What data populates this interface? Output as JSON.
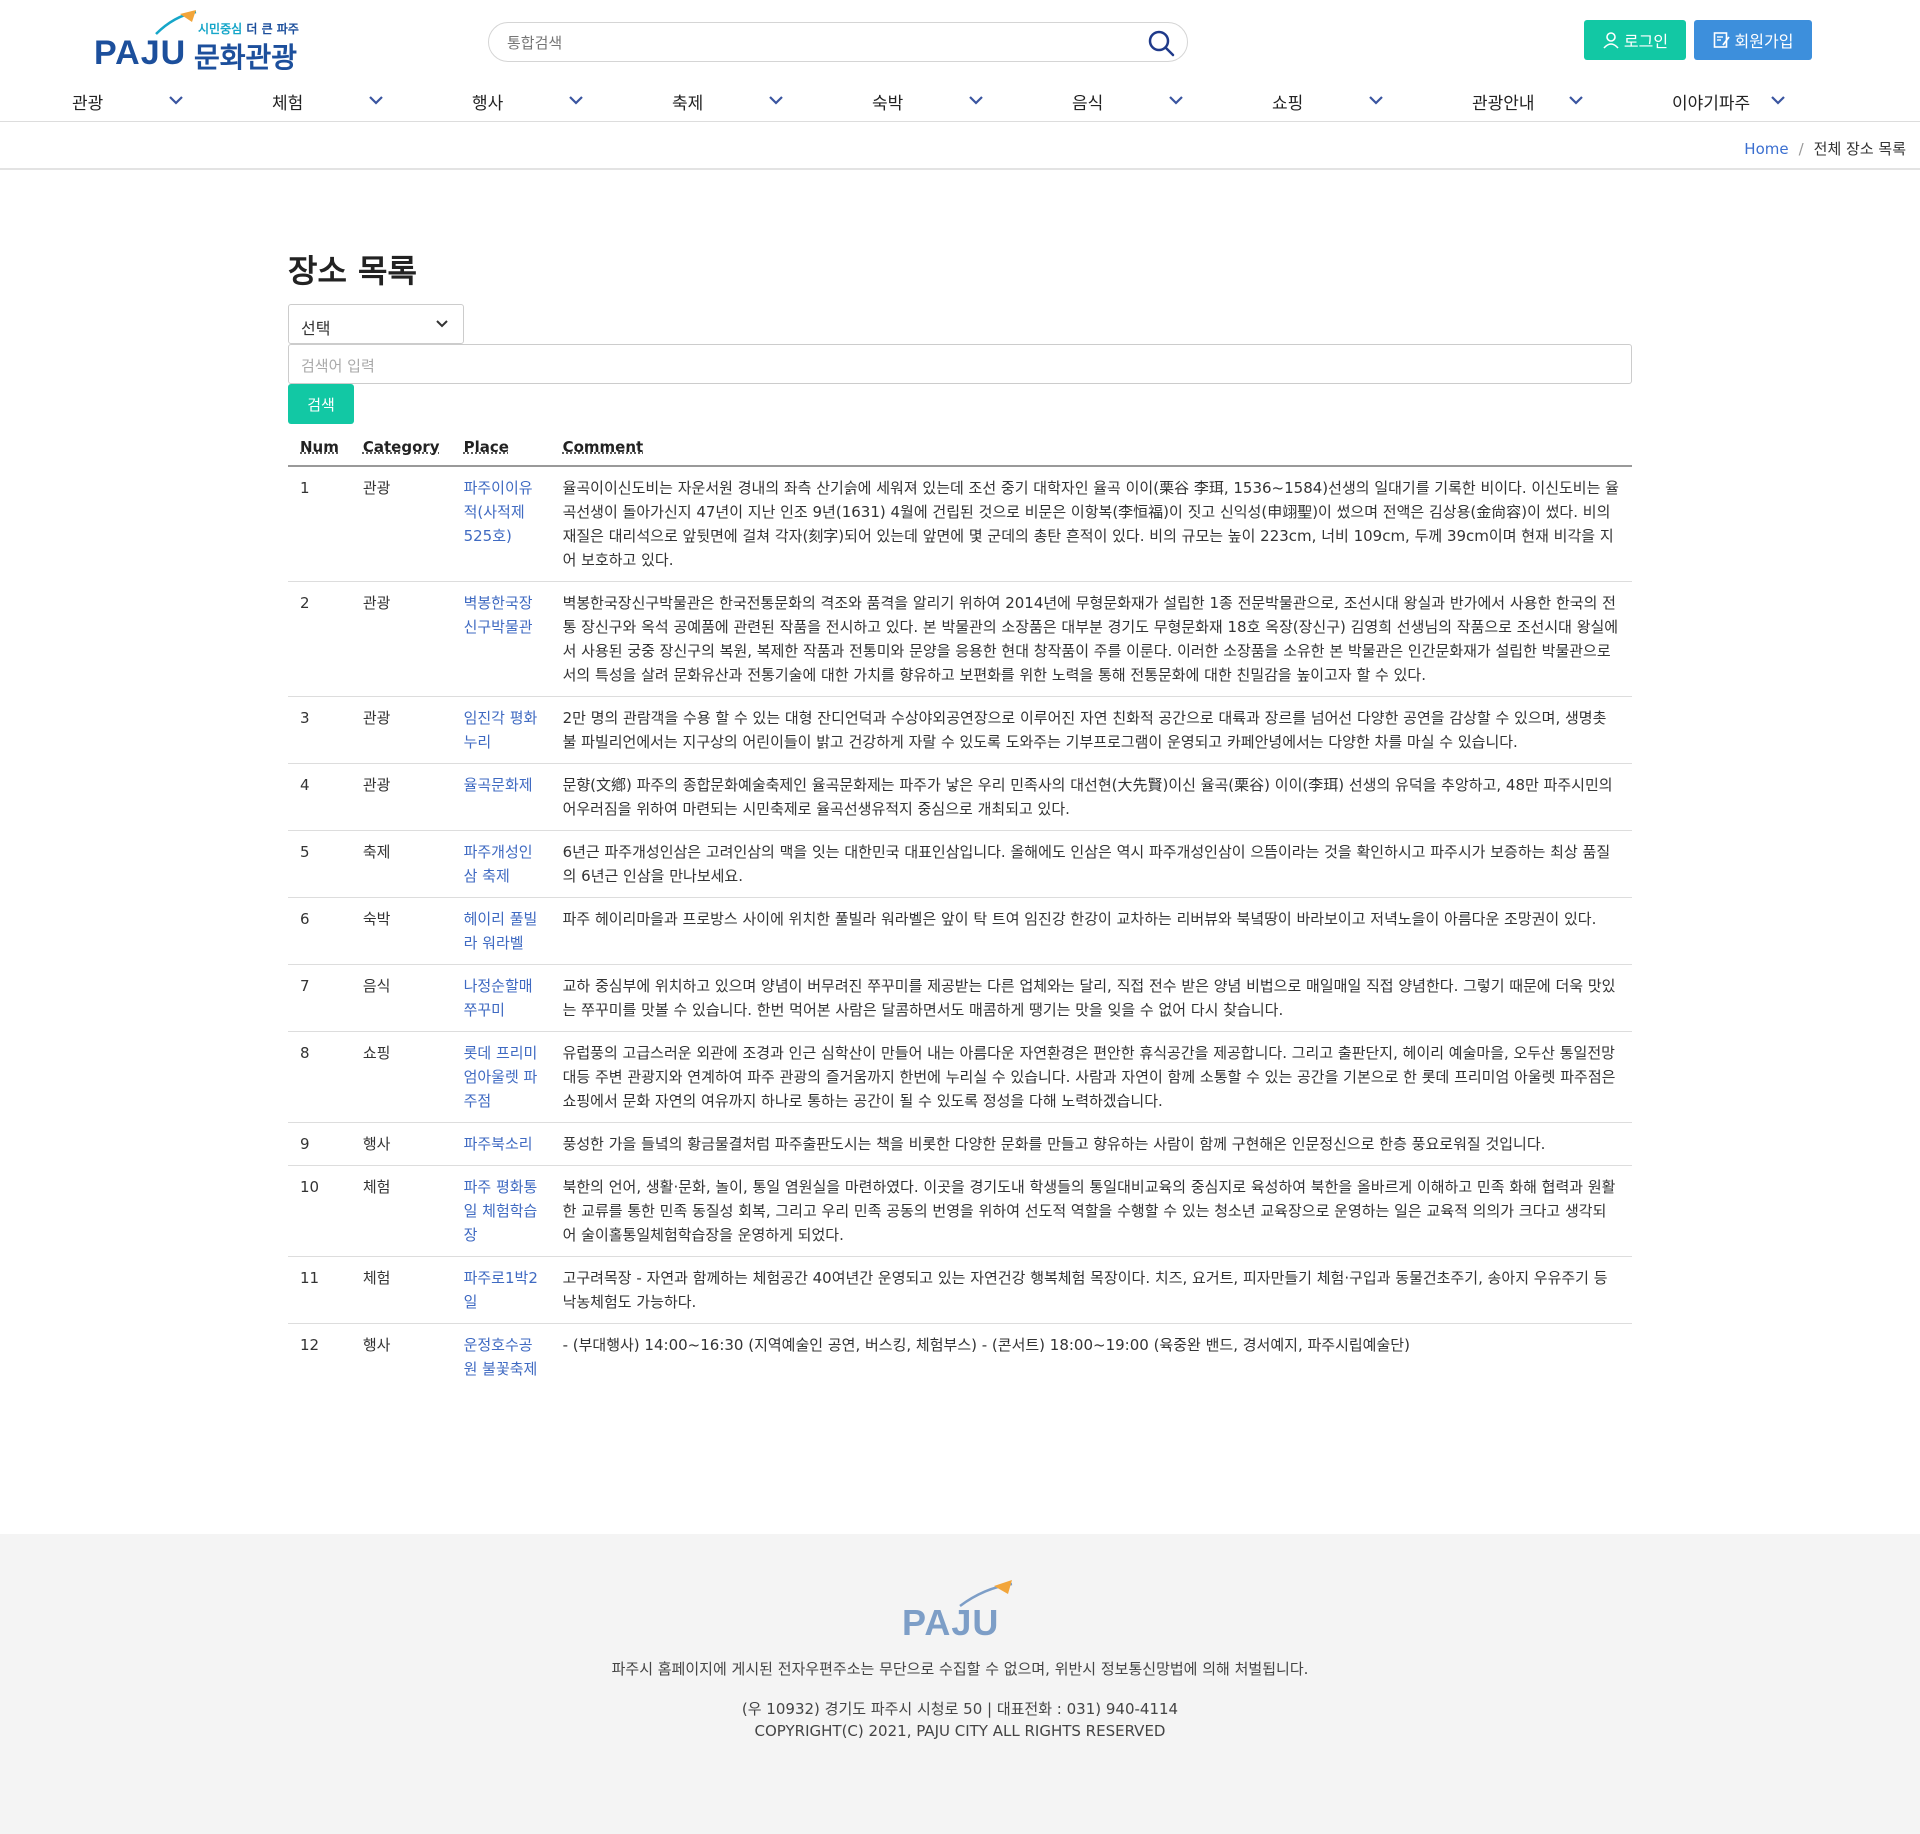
{
  "header": {
    "logo": {
      "paju": "PAJU",
      "small_prefix": "시민중심",
      "small_main": "더 큰 파주",
      "big": "문화관광"
    },
    "search_placeholder": "통합검색",
    "login_label": "로그인",
    "join_label": "회원가입"
  },
  "nav": [
    {
      "label": "관광"
    },
    {
      "label": "체험"
    },
    {
      "label": "행사"
    },
    {
      "label": "축제"
    },
    {
      "label": "숙박"
    },
    {
      "label": "음식"
    },
    {
      "label": "쇼핑"
    },
    {
      "label": "관광안내"
    },
    {
      "label": "이야기파주"
    }
  ],
  "breadcrumb": {
    "home": "Home",
    "sep": "/",
    "current": "전체 장소 목록"
  },
  "main": {
    "title": "장소 목록",
    "select_value": "선택",
    "keyword_placeholder": "검색어 입력",
    "search_button": "검색",
    "columns": [
      "Num",
      "Category",
      "Place",
      "Comment"
    ],
    "rows": [
      {
        "num": "1",
        "category": "관광",
        "place": "파주이이유적(사적제525호)",
        "comment": "율곡이이신도비는 자운서원 경내의 좌측 산기슭에 세워져 있는데 조선 중기 대학자인 율곡 이이(栗谷 李珥, 1536~1584)선생의 일대기를 기록한 비이다. 이신도비는 율곡선생이 돌아가신지 47년이 지난 인조 9년(1631) 4월에 건립된 것으로 비문은 이항복(李恒福)이 짓고 신익성(申翊聖)이 썼으며 전액은 김상용(金尙容)이 썼다. 비의 재질은 대리석으로 앞뒷면에 걸쳐 각자(刻字)되어 있는데 앞면에 몇 군데의 총탄 흔적이 있다. 비의 규모는 높이 223cm, 너비 109cm, 두께 39cm이며 현재 비각을 지어 보호하고 있다."
      },
      {
        "num": "2",
        "category": "관광",
        "place": "벽봉한국장신구박물관",
        "comment": "벽봉한국장신구박물관은 한국전통문화의 격조와 품격을 알리기 위하여 2014년에 무형문화재가 설립한 1종 전문박물관으로, 조선시대 왕실과 반가에서 사용한 한국의 전통 장신구와 옥석 공예품에 관련된 작품을 전시하고 있다. 본 박물관의 소장품은 대부분 경기도 무형문화재 18호 옥장(장신구) 김영희 선생님의 작품으로 조선시대 왕실에서 사용된 궁중 장신구의 복원, 복제한 작품과 전통미와 문양을 응용한 현대 창작품이 주를 이룬다. 이러한 소장품을 소유한 본 박물관은 인간문화재가 설립한 박물관으로서의 특성을 살려 문화유산과 전통기술에 대한 가치를 향유하고 보편화를 위한 노력을 통해 전통문화에 대한 친밀감을 높이고자 할 수 있다."
      },
      {
        "num": "3",
        "category": "관광",
        "place": "임진각 평화누리",
        "comment": "2만 명의 관람객을 수용 할 수 있는 대형 잔디언덕과 수상야외공연장으로 이루어진 자연 친화적 공간으로 대륙과 장르를 넘어선 다양한 공연을 감상할 수 있으며, 생명촛불 파빌리언에서는 지구상의 어린이들이 밝고 건강하게 자랄 수 있도록 도와주는 기부프로그램이 운영되고 카페안녕에서는 다양한 차를 마실 수 있습니다."
      },
      {
        "num": "4",
        "category": "관광",
        "place": "율곡문화제",
        "comment": "문향(文鄕) 파주의 종합문화예술축제인 율곡문화제는 파주가 낳은 우리 민족사의 대선현(大先賢)이신 율곡(栗谷) 이이(李珥) 선생의 유덕을 추앙하고, 48만 파주시민의 어우러짐을 위하여 마련되는 시민축제로 율곡선생유적지 중심으로 개최되고 있다."
      },
      {
        "num": "5",
        "category": "축제",
        "place": "파주개성인삼 축제",
        "comment": "6년근 파주개성인삼은 고려인삼의 맥을 잇는 대한민국 대표인삼입니다. 올해에도 인삼은 역시 파주개성인삼이 으뜸이라는 것을 확인하시고 파주시가 보증하는 최상 품질의 6년근 인삼을 만나보세요."
      },
      {
        "num": "6",
        "category": "숙박",
        "place": "헤이리 풀빌라 워라벨",
        "comment": "파주 헤이리마을과 프로방스 사이에 위치한 풀빌라 워라벨은 앞이 탁 트여 임진강 한강이 교차하는 리버뷰와 북녘땅이 바라보이고 저녁노을이 아름다운 조망권이 있다."
      },
      {
        "num": "7",
        "category": "음식",
        "place": "나정순할매쭈꾸미",
        "comment": "교하 중심부에 위치하고 있으며 양념이 버무려진 쭈꾸미를 제공받는 다른 업체와는 달리, 직접 전수 받은 양념 비법으로 매일매일 직접 양념한다. 그렇기 때문에 더욱 맛있는 쭈꾸미를 맛볼 수 있습니다. 한번 먹어본 사람은 달콤하면서도 매콤하게 땡기는 맛을 잊을 수 없어 다시 찾습니다."
      },
      {
        "num": "8",
        "category": "쇼핑",
        "place": "롯데 프리미엄아울렛 파주점",
        "comment": "유럽풍의 고급스러운 외관에 조경과 인근 심학산이 만들어 내는 아름다운 자연환경은 편안한 휴식공간을 제공합니다. 그리고 출판단지, 헤이리 예술마을, 오두산 통일전망대등 주변 관광지와 연계하여 파주 관광의 즐거움까지 한번에 누리실 수 있습니다. 사람과 자연이 함께 소통할 수 있는 공간을 기본으로 한 롯데 프리미엄 아울렛 파주점은 쇼핑에서 문화 자연의 여유까지 하나로 통하는 공간이 될 수 있도록 정성을 다해 노력하겠습니다."
      },
      {
        "num": "9",
        "category": "행사",
        "place": "파주북소리",
        "comment": "풍성한 가을 들녘의 황금물결처럼 파주출판도시는 책을 비롯한 다양한 문화를 만들고 향유하는 사람이 함께 구현해온 인문정신으로 한층 풍요로워질 것입니다."
      },
      {
        "num": "10",
        "category": "체험",
        "place": "파주 평화통일 체험학습장",
        "comment": "북한의 언어, 생활·문화, 놀이, 통일 염원실을 마련하였다. 이곳을 경기도내 학생들의 통일대비교육의 중심지로 육성하여 북한을 올바르게 이해하고 민족 화해 협력과 원활한 교류를 통한 민족 동질성 회복, 그리고 우리 민족 공동의 번영을 위하여 선도적 역할을 수행할 수 있는 청소년 교육장으로 운영하는 일은 교육적 의의가 크다고 생각되어 술이홀통일체험학습장을 운영하게 되었다."
      },
      {
        "num": "11",
        "category": "체험",
        "place": "파주로1박2일",
        "comment": "고구려목장 - 자연과 함께하는 체험공간 40여년간 운영되고 있는 자연건강 행복체험 목장이다. 치즈, 요거트, 피자만들기 체험·구입과 동물건초주기, 송아지 우유주기 등 낙농체험도 가능하다."
      },
      {
        "num": "12",
        "category": "행사",
        "place": "운정호수공원 불꽃축제",
        "comment": "- (부대행사) 14:00~16:30 (지역예술인 공연, 버스킹, 체험부스) - (콘서트) 18:00~19:00 (육중완 밴드, 경서예지, 파주시립예술단)"
      }
    ]
  },
  "footer": {
    "logo": "PAJU",
    "notice": "파주시 홈페이지에 게시된 전자우편주소는 무단으로 수집할 수 없으며, 위반시 정보통신망법에 의해 처벌됩니다.",
    "address": "(우 10932) 경기도 파주시 시청로 50 | 대표전화 : 031) 940-4114",
    "copyright": "COPYRIGHT(C) 2021, PAJU CITY ALL RIGHTS RESERVED"
  },
  "colors": {
    "brand_blue": "#1c4f9c",
    "teal": "#12c8a4",
    "join_blue": "#3d8fdc",
    "link": "#3f6ac2"
  }
}
